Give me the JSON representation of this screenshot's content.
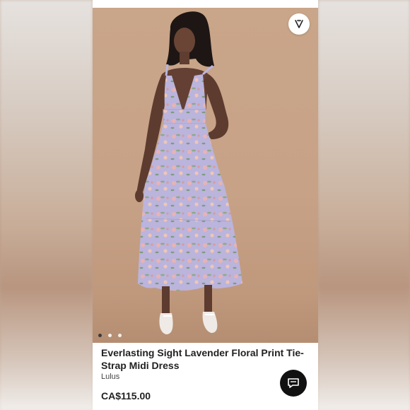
{
  "listing": {
    "title": "Everlasting Sight Lavender Floral Print Tie-Strap Midi Dress",
    "brand": "Lulus",
    "price": "CA$115.00"
  },
  "gallery": {
    "total_images": 3,
    "active_index": 0
  },
  "icons": {
    "like": "heart-v-icon",
    "chat": "chat-bubble-icon"
  },
  "colors": {
    "background": "#c7a287",
    "dress": "#b9b3da",
    "chat_button": "#111111"
  }
}
